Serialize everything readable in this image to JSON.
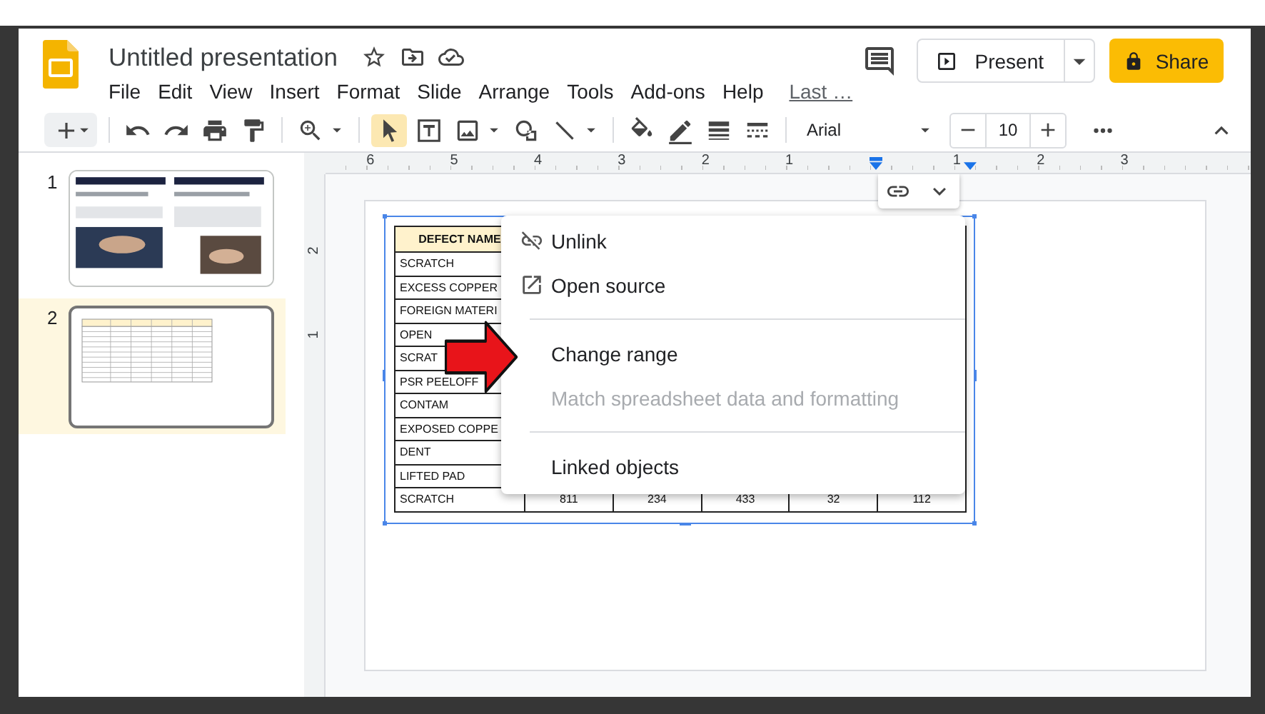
{
  "header": {
    "title": "Untitled presentation",
    "menus": [
      "File",
      "Edit",
      "View",
      "Insert",
      "Format",
      "Slide",
      "Arrange",
      "Tools",
      "Add-ons",
      "Help"
    ],
    "last_edit_link": "Last …",
    "present_button": "Present",
    "share_button": "Share"
  },
  "toolbar": {
    "pointer_tool": {
      "selected": true
    },
    "font": "Arial",
    "font_size": "10"
  },
  "filmstrip": {
    "slides": [
      {
        "number": "1",
        "selected": false,
        "kind": "picture"
      },
      {
        "number": "2",
        "selected": true,
        "kind": "table"
      }
    ]
  },
  "rulers": {
    "horizontal": [
      "6",
      "5",
      "4",
      "3",
      "2",
      "1",
      "1",
      "2",
      "3"
    ],
    "vertical": [
      "2",
      "1"
    ]
  },
  "table": {
    "header": [
      "DEFECT NAME"
    ],
    "rows": [
      {
        "cells": [
          "SCRATCH"
        ]
      },
      {
        "cells": [
          "EXCESS COPPER"
        ]
      },
      {
        "cells": [
          "FOREIGN MATERI"
        ]
      },
      {
        "cells": [
          "OPEN"
        ]
      },
      {
        "cells": [
          "SCRAT"
        ]
      },
      {
        "cells": [
          "PSR PEELOFF"
        ]
      },
      {
        "cells": [
          "CONTAM"
        ]
      },
      {
        "cells": [
          "EXPOSED COPPE"
        ]
      },
      {
        "cells": [
          "DENT"
        ]
      },
      {
        "cells": [
          "LIFTED PAD"
        ]
      },
      {
        "cells": [
          "SCRATCH",
          "811",
          "234",
          "433",
          "32",
          "112"
        ]
      }
    ]
  },
  "context_menu": {
    "items": [
      {
        "kind": "item",
        "label": "Unlink",
        "disabled": false
      },
      {
        "kind": "item",
        "label": "Open source",
        "disabled": false
      },
      {
        "kind": "separator"
      },
      {
        "kind": "item",
        "label": "Change range",
        "disabled": false
      },
      {
        "kind": "item",
        "label": "Match spreadsheet data and formatting",
        "disabled": true
      },
      {
        "kind": "separator"
      },
      {
        "kind": "item",
        "label": "Linked objects",
        "disabled": false
      }
    ]
  }
}
